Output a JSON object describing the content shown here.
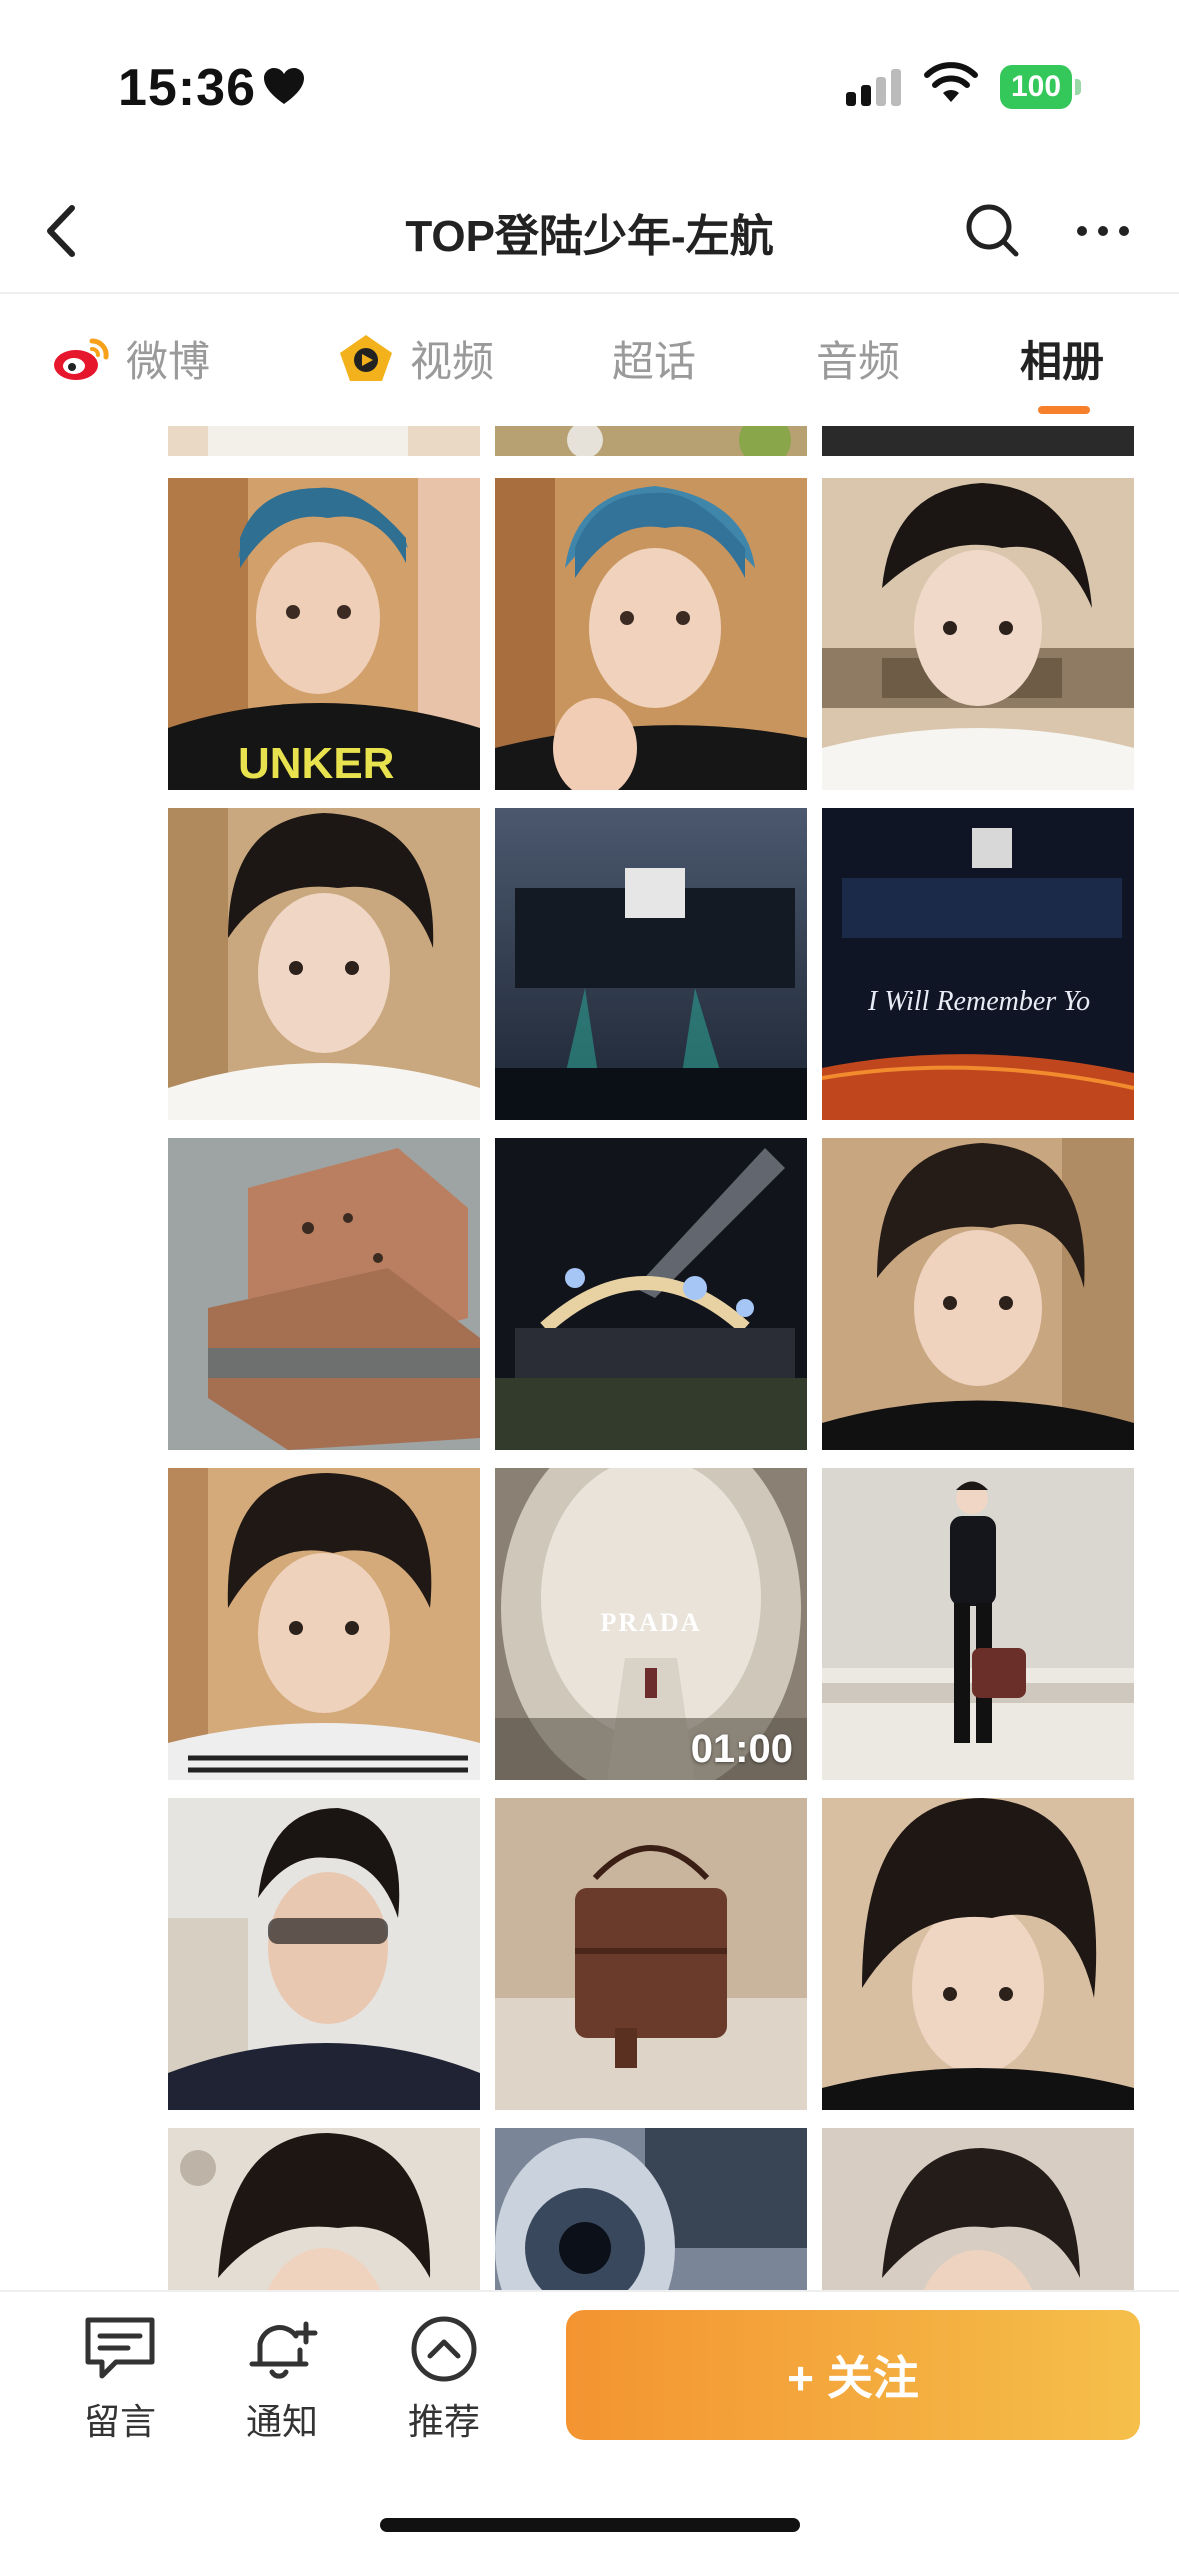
{
  "status_bar": {
    "time": "15:36",
    "battery": "100"
  },
  "nav": {
    "title": "TOP登陆少年-左航"
  },
  "tabs": [
    {
      "label": "微博",
      "icon": "weibo-logo-icon"
    },
    {
      "label": "视频",
      "icon": "video-icon"
    },
    {
      "label": "超话",
      "icon": ""
    },
    {
      "label": "音频",
      "icon": ""
    },
    {
      "label": "相册",
      "icon": "",
      "active": true
    }
  ],
  "album": {
    "video_duration": "01:00",
    "prada_text": "PRADA",
    "concert_text": "I Will Remember Yo"
  },
  "bottom": {
    "comment_label": "留言",
    "notify_label": "通知",
    "recommend_label": "推荐",
    "follow_label": "+ 关注"
  },
  "colors": {
    "accent": "#f7802c",
    "follow_gradient_start": "#f39431",
    "follow_gradient_end": "#f5bf4a",
    "battery": "#34c759"
  }
}
